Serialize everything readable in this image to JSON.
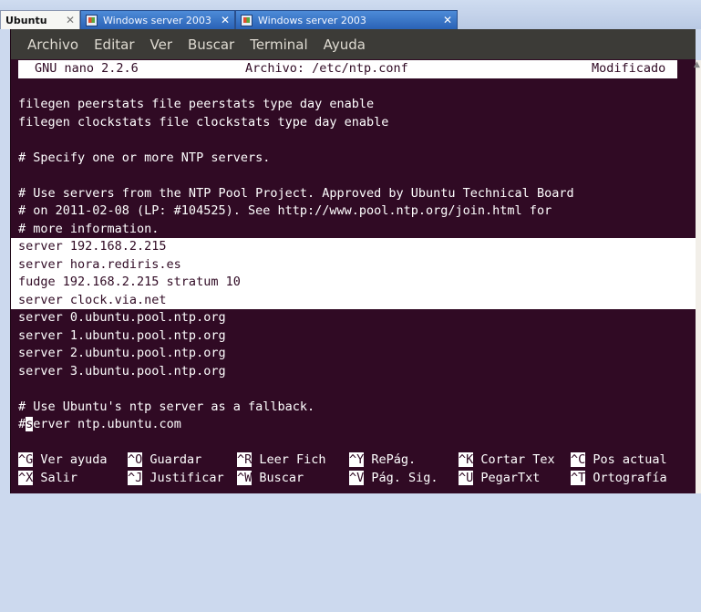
{
  "tabs": [
    {
      "label": "Ubuntu",
      "close": "✕"
    },
    {
      "label": "Windows server 2003",
      "close": "✕"
    },
    {
      "label": "Windows server 2003",
      "close": "✕"
    }
  ],
  "menu": [
    "Archivo",
    "Editar",
    "Ver",
    "Buscar",
    "Terminal",
    "Ayuda"
  ],
  "nano": {
    "version": "GNU nano 2.2.6",
    "file": "Archivo: /etc/ntp.conf",
    "status": "Modificado"
  },
  "content": [
    "",
    "filegen peerstats file peerstats type day enable",
    "filegen clockstats file clockstats type day enable",
    "",
    "# Specify one or more NTP servers.",
    "",
    "# Use servers from the NTP Pool Project. Approved by Ubuntu Technical Board",
    "# on 2011-02-08 (LP: #104525). See http://www.pool.ntp.org/join.html for",
    "# more information."
  ],
  "selected": [
    "server 192.168.2.215",
    "server hora.rediris.es",
    "fudge 192.168.2.215 stratum 10",
    "server clock.via.net"
  ],
  "content2": [
    "server 0.ubuntu.pool.ntp.org",
    "server 1.ubuntu.pool.ntp.org",
    "server 2.ubuntu.pool.ntp.org",
    "server 3.ubuntu.pool.ntp.org",
    "",
    "# Use Ubuntu's ntp server as a fallback."
  ],
  "cursor_line": {
    "before": "#",
    "cursor": "s",
    "after": "erver ntp.ubuntu.com"
  },
  "shortcuts_row1": [
    {
      "key": "^G",
      "label": "Ver ayuda"
    },
    {
      "key": "^O",
      "label": "Guardar"
    },
    {
      "key": "^R",
      "label": "Leer Fich"
    },
    {
      "key": "^Y",
      "label": "RePág."
    },
    {
      "key": "^K",
      "label": "Cortar Tex"
    },
    {
      "key": "^C",
      "label": "Pos actual"
    }
  ],
  "shortcuts_row2": [
    {
      "key": "^X",
      "label": "Salir"
    },
    {
      "key": "^J",
      "label": "Justificar"
    },
    {
      "key": "^W",
      "label": "Buscar"
    },
    {
      "key": "^V",
      "label": "Pág. Sig."
    },
    {
      "key": "^U",
      "label": "PegarTxt"
    },
    {
      "key": "^T",
      "label": "Ortografía"
    }
  ],
  "colors": {
    "terminal_bg": "#300a24",
    "menubar_bg": "#3c3b37",
    "text": "#ffffff",
    "tab_active": "#2a62b6"
  }
}
